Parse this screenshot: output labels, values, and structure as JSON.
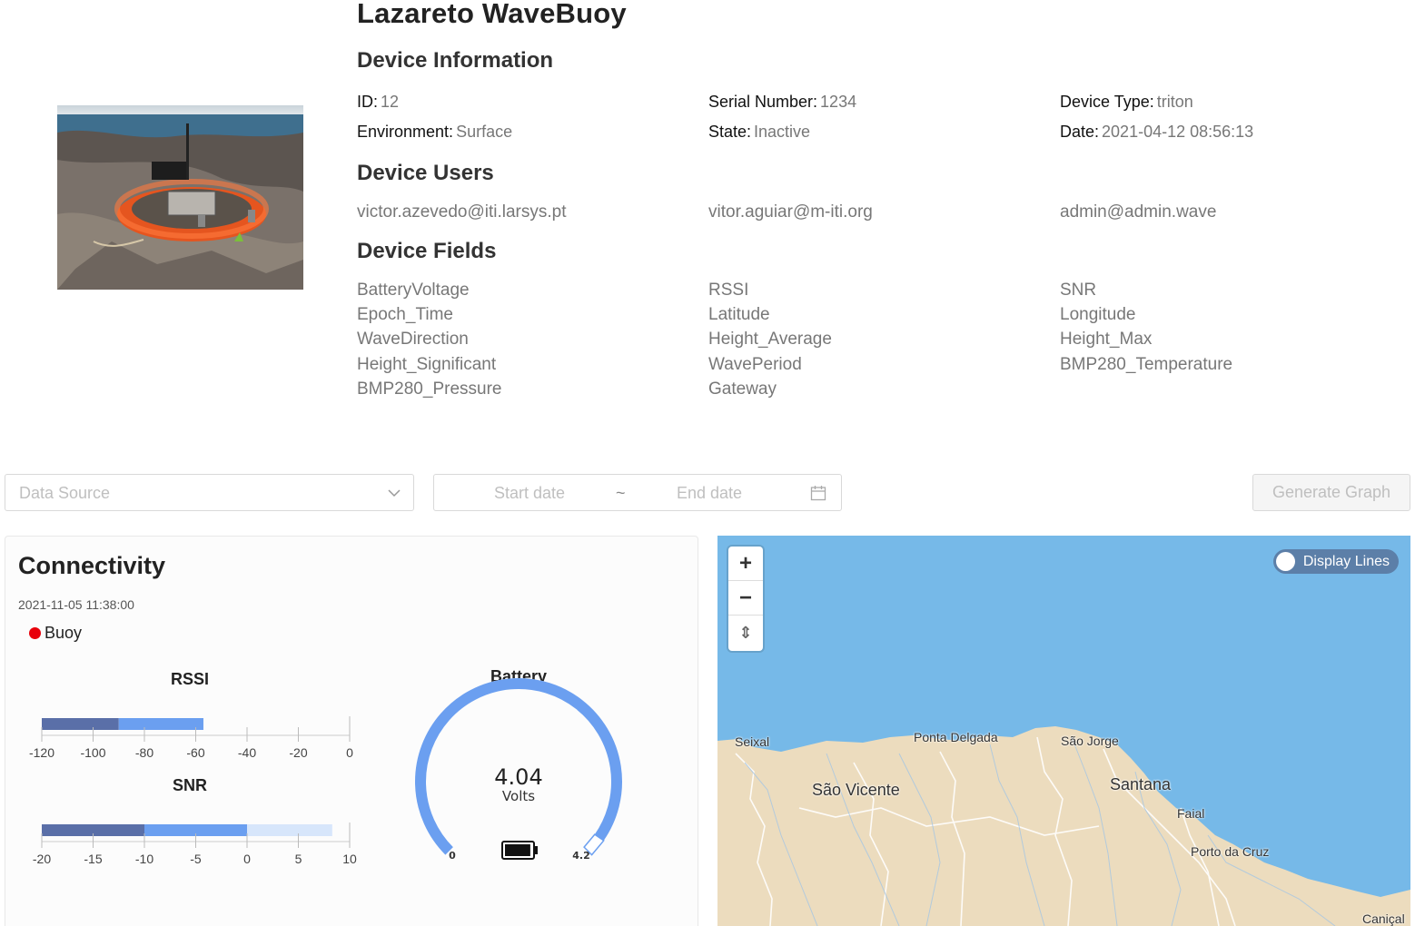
{
  "device": {
    "title": "Lazareto WaveBuoy",
    "info_heading": "Device Information",
    "info": {
      "id_label": "ID:",
      "id_value": "12",
      "serial_label": "Serial Number:",
      "serial_value": "1234",
      "type_label": "Device Type:",
      "type_value": "triton",
      "env_label": "Environment:",
      "env_value": "Surface",
      "state_label": "State:",
      "state_value": "Inactive",
      "date_label": "Date:",
      "date_value": "2021-04-12 08:56:13"
    },
    "users_heading": "Device Users",
    "users": [
      "victor.azevedo@iti.larsys.pt",
      "vitor.aguiar@m-iti.org",
      "admin@admin.wave"
    ],
    "fields_heading": "Device Fields",
    "fields": [
      "BatteryVoltage",
      "RSSI",
      "SNR",
      "Epoch_Time",
      "Latitude",
      "Longitude",
      "WaveDirection",
      "Height_Average",
      "Height_Max",
      "Height_Significant",
      "WavePeriod",
      "BMP280_Temperature",
      "BMP280_Pressure",
      "Gateway"
    ]
  },
  "filters": {
    "data_source_placeholder": "Data Source",
    "start_placeholder": "Start date",
    "separator": "~",
    "end_placeholder": "End date",
    "generate_label": "Generate Graph"
  },
  "connectivity": {
    "title": "Connectivity",
    "timestamp": "2021-11-05 11:38:00",
    "legend_label": "Buoy",
    "legend_color": "#e8000b",
    "rssi": {
      "label": "RSSI",
      "min": -120,
      "max": 0,
      "ticks": [
        -120,
        -100,
        -80,
        -60,
        -40,
        -20,
        0
      ],
      "bands": [
        {
          "from": -120,
          "to": -90,
          "color": "#5a6fa8"
        },
        {
          "from": -90,
          "to": -57,
          "color": "#6b9ff0"
        }
      ]
    },
    "snr": {
      "label": "SNR",
      "min": -20,
      "max": 10,
      "ticks": [
        -20,
        -15,
        -10,
        -5,
        0,
        5,
        10
      ],
      "bands": [
        {
          "from": -20,
          "to": -10,
          "color": "#5a6fa8"
        },
        {
          "from": -10,
          "to": 0,
          "color": "#6b9ff0"
        },
        {
          "from": 0,
          "to": 8.3,
          "color": "#d7e6fb"
        }
      ]
    },
    "battery": {
      "label": "Battery",
      "value_text": "4.04",
      "value": 4.04,
      "unit": "Volts",
      "min": 0,
      "max": 4.2,
      "min_label": "0",
      "max_label": "4.2",
      "color": "#6b9ff0"
    }
  },
  "map": {
    "display_lines_label": "Display Lines",
    "zoom_in": "+",
    "zoom_out": "−",
    "reset_north": "⇕",
    "places": [
      {
        "name": "Seixal",
        "size": "small"
      },
      {
        "name": "Ponta Delgada",
        "size": "small"
      },
      {
        "name": "São Jorge",
        "size": "small"
      },
      {
        "name": "São Vicente",
        "size": "large"
      },
      {
        "name": "Santana",
        "size": "large"
      },
      {
        "name": "Faial",
        "size": "small"
      },
      {
        "name": "Porto da Cruz",
        "size": "small"
      },
      {
        "name": "Caniçal",
        "size": "small"
      }
    ],
    "sea_color": "#76b9e8",
    "land_color": "#ecdcbe"
  }
}
